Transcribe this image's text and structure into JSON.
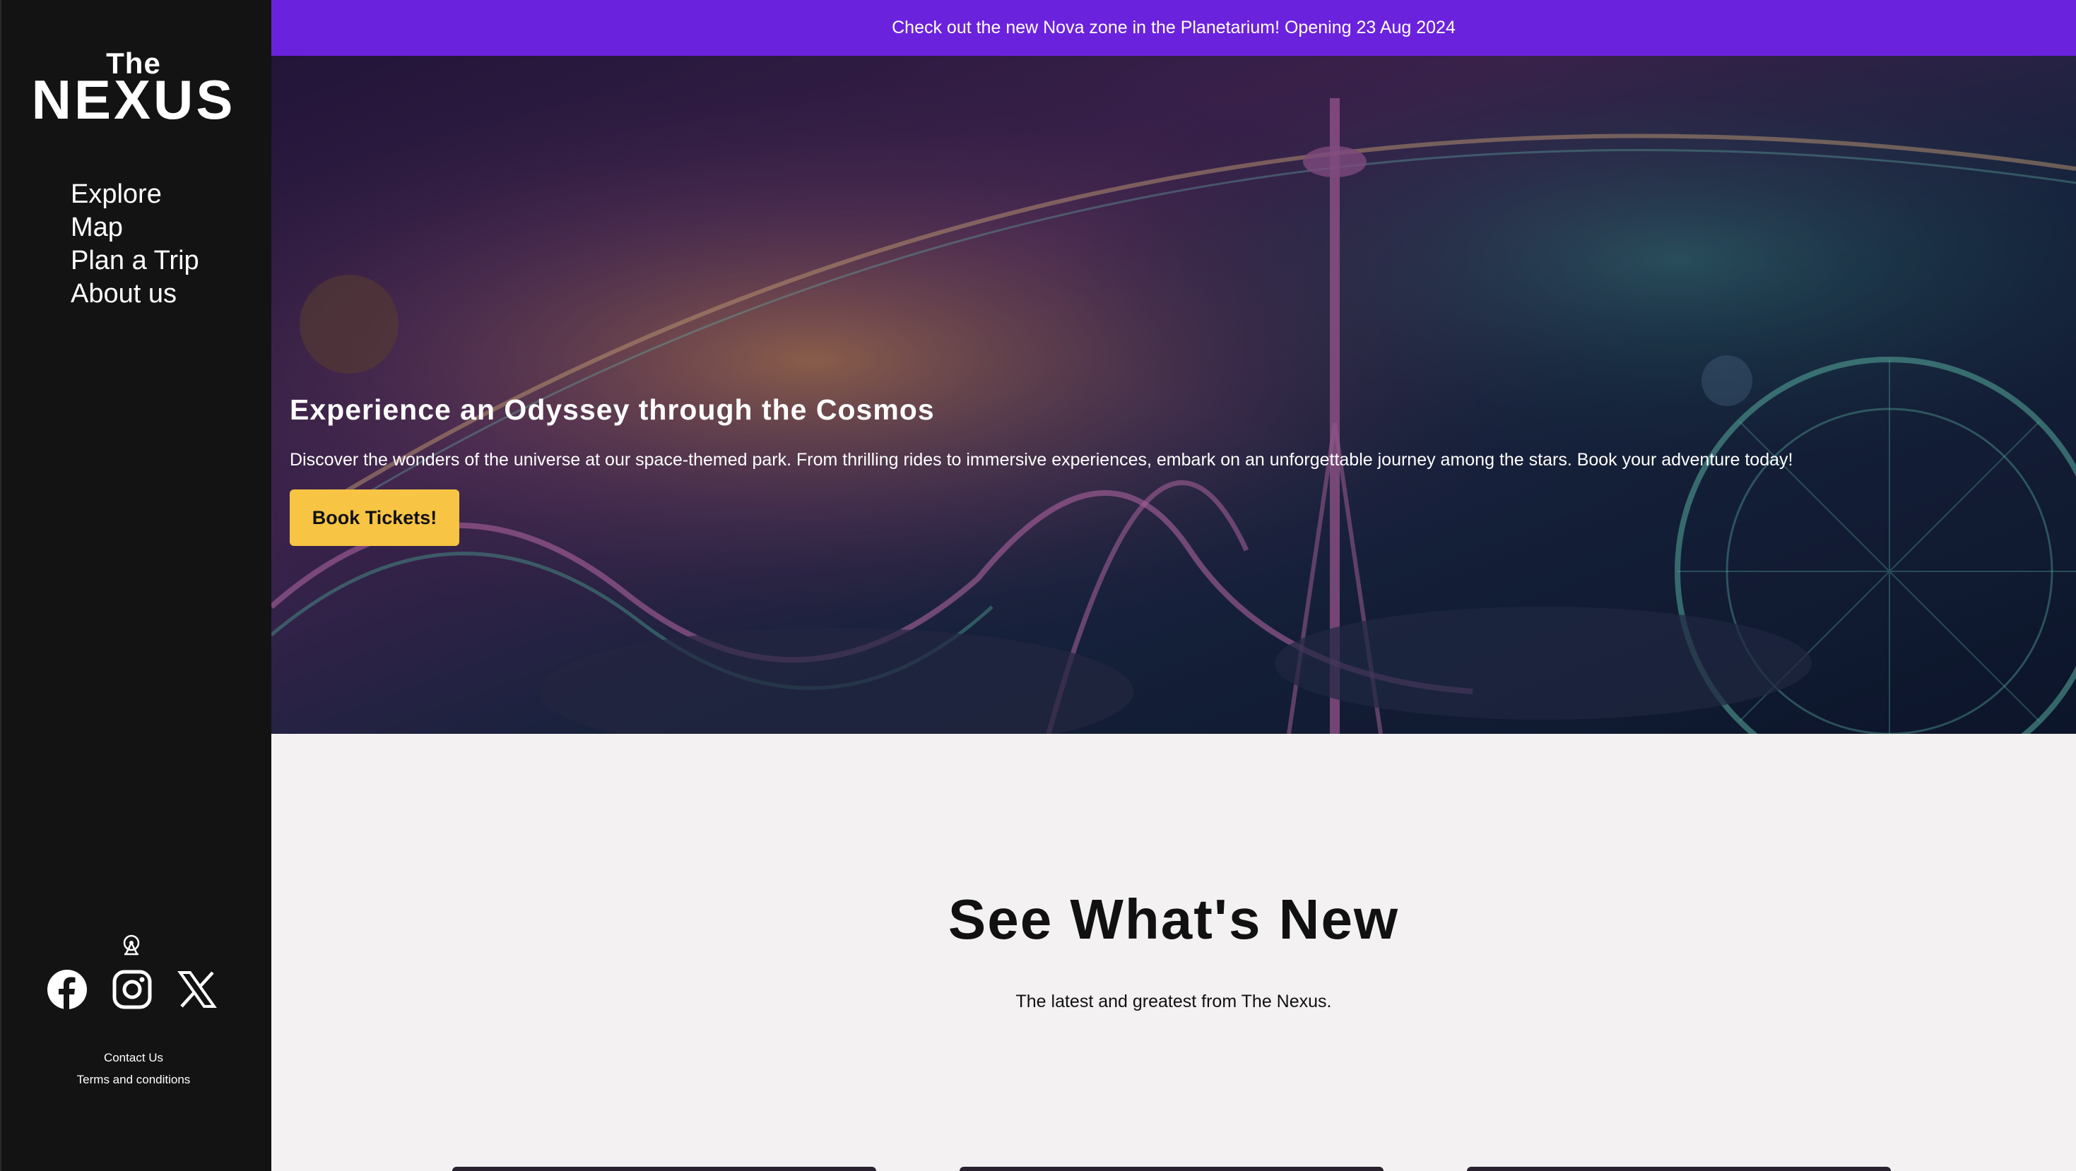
{
  "brand": {
    "line1": "The",
    "line2": "NEXUS"
  },
  "nav": [
    {
      "label": "Explore"
    },
    {
      "label": "Map"
    },
    {
      "label": "Plan a Trip"
    },
    {
      "label": "About us"
    }
  ],
  "social_icons": [
    "ferris-wheel-icon",
    "facebook-icon",
    "instagram-icon",
    "x-icon"
  ],
  "footer": {
    "contact": "Contact Us",
    "terms": "Terms and conditions"
  },
  "banner": {
    "text": "Check out the new Nova zone in the Planetarium! Opening 23 Aug 2024"
  },
  "hero": {
    "title": "Experience an Odyssey through the Cosmos",
    "text": "Discover the wonders of the universe at our space-themed park. From thrilling rides to immersive experiences, embark on an unforgettable journey among the stars. Book your adventure today!",
    "button_label": "Book Tickets!"
  },
  "whats_new": {
    "title": "See What's New",
    "subtitle": "The latest and greatest from The Nexus."
  },
  "colors": {
    "sidebar": "#131313",
    "banner": "#6b22dd",
    "button": "#f7c443",
    "page_bg": "#f3f1f2"
  }
}
